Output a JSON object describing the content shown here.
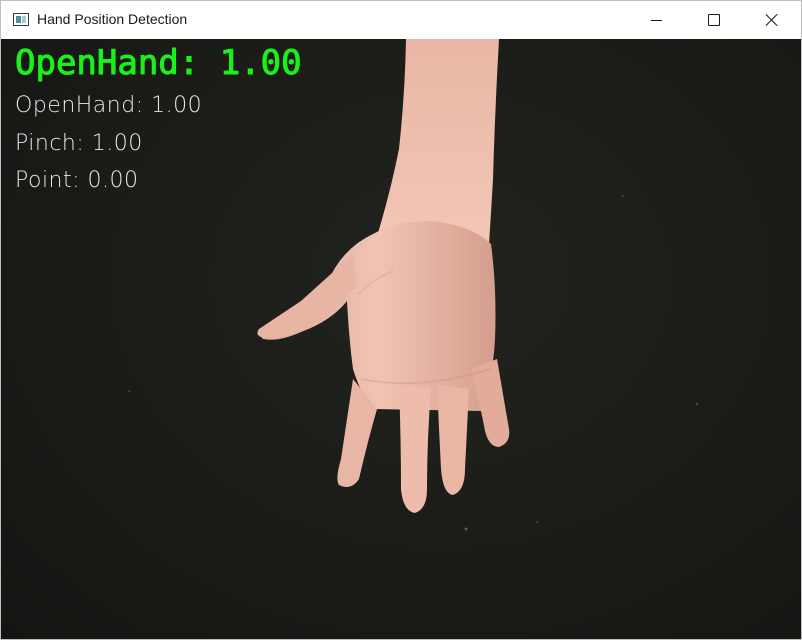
{
  "window": {
    "title": "Hand Position Detection"
  },
  "overlay": {
    "detected": "OpenHand: 1.00",
    "scores": [
      {
        "label": "OpenHand: 1.00"
      },
      {
        "label": "Pinch: 1.00"
      },
      {
        "label": "Point: 0.00"
      }
    ],
    "colors": {
      "detected": "#19f219",
      "scores": "#e8e8e8"
    }
  },
  "icons": {
    "app": "app-window-icon",
    "minimize": "minimize-icon",
    "maximize": "maximize-icon",
    "close": "close-icon"
  }
}
